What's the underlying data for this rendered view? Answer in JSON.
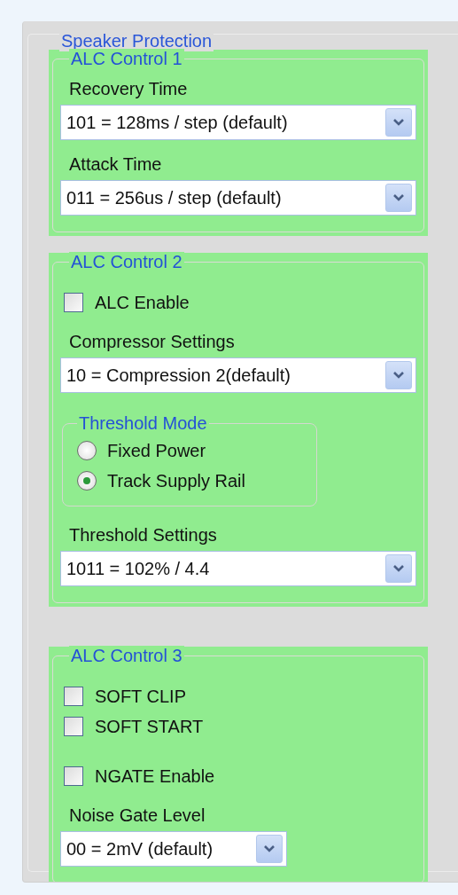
{
  "group": {
    "title": "Speaker Protection"
  },
  "sections": [
    {
      "title": "ALC Control 1",
      "items": [
        {
          "kind": "dropdown",
          "label": "Recovery Time",
          "value": "101 = 128ms / step (default)"
        },
        {
          "kind": "dropdown",
          "label": "Attack Time",
          "value": "011 = 256us / step (default)"
        }
      ]
    },
    {
      "title": "ALC Control 2",
      "items": [
        {
          "kind": "checkbox",
          "label": "ALC Enable",
          "checked": false
        },
        {
          "kind": "dropdown",
          "label": "Compressor Settings",
          "value": "10 = Compression 2(default)"
        },
        {
          "kind": "radio_group",
          "title": "Threshold Mode",
          "options": [
            {
              "label": "Fixed Power",
              "selected": false
            },
            {
              "label": "Track Supply Rail",
              "selected": true
            }
          ]
        },
        {
          "kind": "dropdown",
          "label": "Threshold Settings",
          "value": "1011 = 102% / 4.4"
        }
      ]
    },
    {
      "title": "ALC Control 3",
      "items": [
        {
          "kind": "checkbox",
          "label": "SOFT CLIP",
          "checked": false
        },
        {
          "kind": "checkbox",
          "label": "SOFT START",
          "checked": false
        },
        {
          "kind": "checkbox",
          "label": "NGATE Enable",
          "checked": false
        },
        {
          "kind": "dropdown",
          "label": "Noise Gate Level",
          "value": "00 = 2mV (default)"
        }
      ]
    }
  ]
}
